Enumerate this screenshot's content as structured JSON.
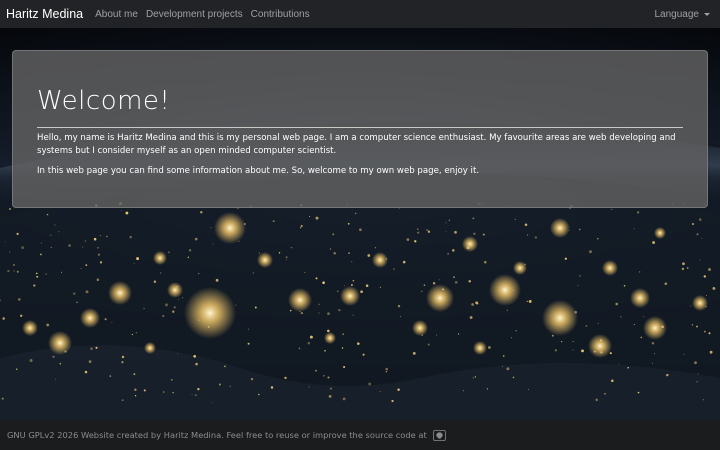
{
  "navbar": {
    "brand": "Haritz Medina",
    "links": [
      "About me",
      "Development projects",
      "Contributions"
    ],
    "language_label": "Language"
  },
  "jumbotron": {
    "title": "Welcome!",
    "paragraphs": [
      "Hello, my name is Haritz Medina and this is my personal web page. I am a computer science enthusiast. My favourite areas are web developing and systems but I consider myself as an open minded computer scientist.",
      "In this web page you can find some information about me. So, welcome to my own web page, enjoy it."
    ]
  },
  "footer": {
    "text": "GNU GPLv2 2026 Website created by Haritz Medina. Feel free to reuse or improve the source code at",
    "icon": "github-icon"
  },
  "colors": {
    "navbar_bg": "#222326",
    "footer_bg": "#1b1c1e",
    "jumbotron_bg": "#626262",
    "nav_link": "#9ea0a4",
    "city_lights": "#f5d27a"
  }
}
